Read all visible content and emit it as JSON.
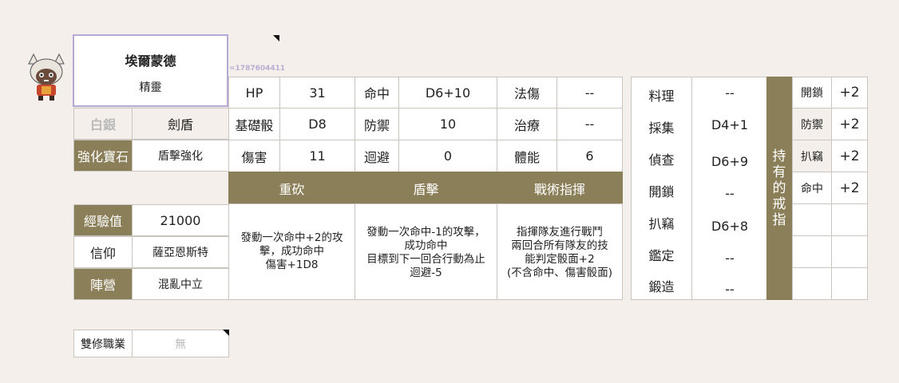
{
  "character": {
    "name": "埃爾蒙德",
    "race": "精靈",
    "id_text": "=1787604411"
  },
  "left_panel": {
    "class_tier": "白銀",
    "class_name": "劍盾",
    "enhance_label": "強化寶石",
    "enhance_value": "盾擊強化",
    "exp_label": "經驗值",
    "exp_value": "21000",
    "faith_label": "信仰",
    "faith_value": "薩亞恩斯特",
    "alignment_label": "陣營",
    "alignment_value": "混亂中立"
  },
  "dual_class": {
    "label": "雙修職業",
    "value": "無"
  },
  "stats": {
    "hp_label": "HP",
    "hp_value": "31",
    "basedice_label": "基礎骰",
    "basedice_value": "D8",
    "damage_label": "傷害",
    "damage_value": "11",
    "hit_label": "命中",
    "hit_value": "D6+10",
    "defense_label": "防禦",
    "defense_value": "10",
    "evade_label": "迴避",
    "evade_value": "0",
    "magic_label": "法傷",
    "magic_value": "--",
    "heal_label": "治療",
    "heal_value": "--",
    "stamina_label": "體能",
    "stamina_value": "6"
  },
  "skills": [
    {
      "name": "重砍",
      "desc": [
        "發動一次命中+2的攻",
        "擊，成功命中",
        "傷害+1D8"
      ]
    },
    {
      "name": "盾擊",
      "desc": [
        "發動一次命中-1的攻擊，",
        "成功命中",
        "目標到下一回合行動為止",
        "迴避-5"
      ]
    },
    {
      "name": "戰術指揮",
      "desc": [
        "指揮隊友進行戰鬥",
        "兩回合所有隊友的技",
        "能判定骰面+2",
        "(不含命中、傷害骰面)"
      ]
    }
  ],
  "life_skills": [
    {
      "label": "料理",
      "value": "--"
    },
    {
      "label": "採集",
      "value": "D4+1"
    },
    {
      "label": "偵查",
      "value": "D6+9"
    },
    {
      "label": "開鎖",
      "value": "--"
    },
    {
      "label": "扒竊",
      "value": "D6+8"
    },
    {
      "label": "鑑定",
      "value": "--"
    },
    {
      "label": "鍛造",
      "value": "--"
    }
  ],
  "rings": {
    "title": "持有的戒指",
    "title_chars": [
      "持",
      "有",
      "的",
      "戒",
      "指"
    ],
    "items": [
      {
        "label": "開鎖",
        "value": "+2"
      },
      {
        "label": "防禦",
        "value": "+2"
      },
      {
        "label": "扒竊",
        "value": "+2"
      },
      {
        "label": "命中",
        "value": "+2"
      }
    ]
  }
}
